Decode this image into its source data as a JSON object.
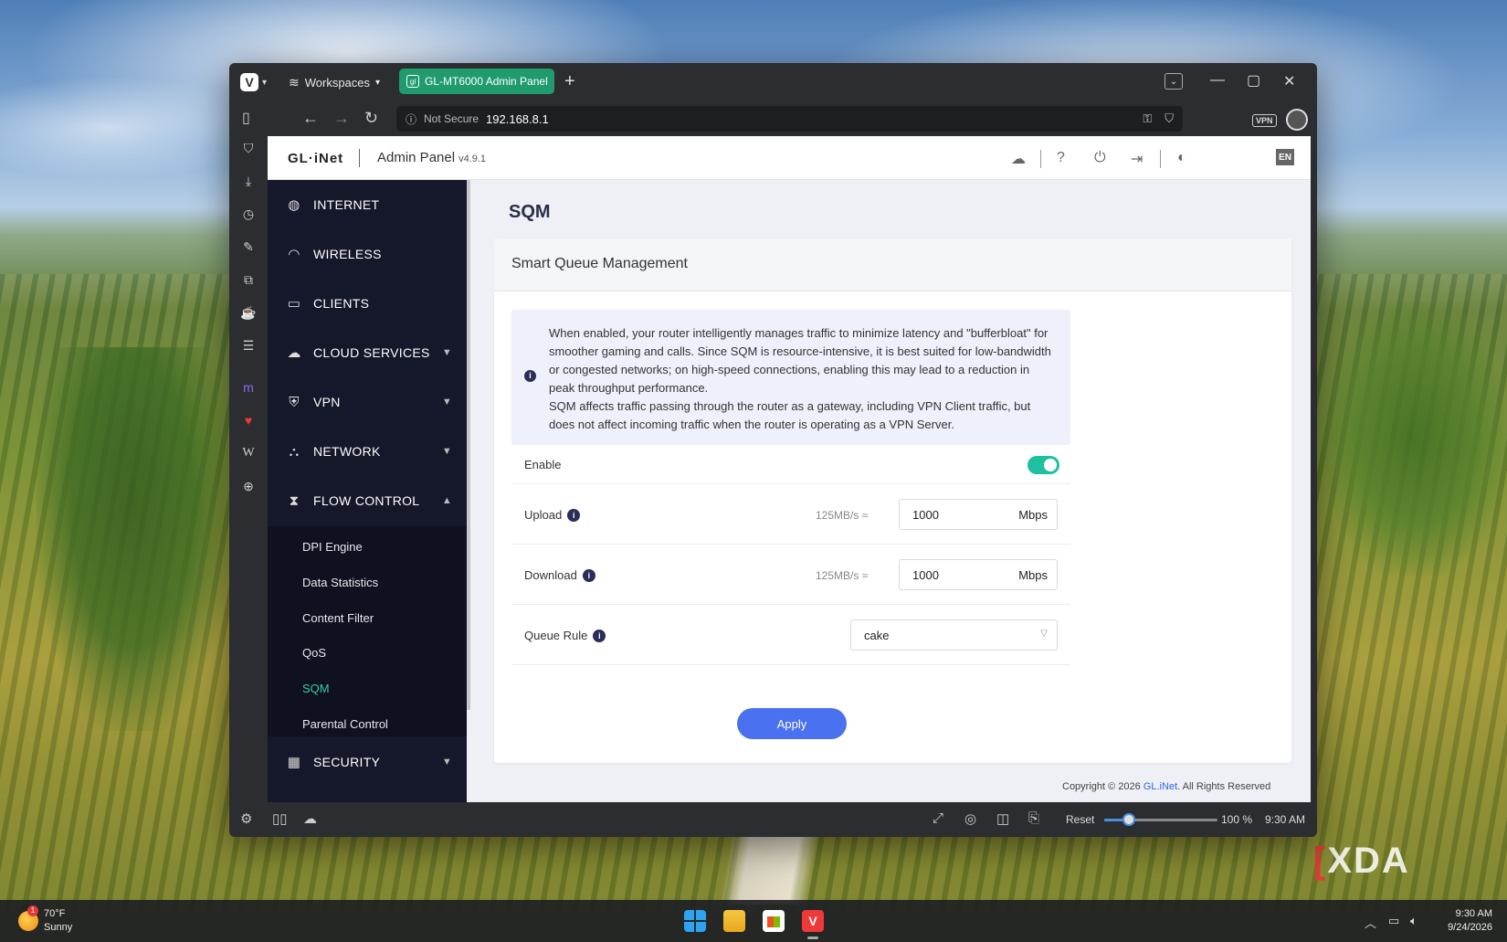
{
  "browser": {
    "workspaces_label": "Workspaces",
    "tab_title": "GL-MT6000 Admin Panel",
    "tab_favicon": "gl",
    "url_security": "Not Secure",
    "url_host": "192.168.8.1",
    "vpn_label": "VPN",
    "statusbar": {
      "reset_label": "Reset",
      "zoom_label": "100 %",
      "zoom_level": 0.22,
      "time": "9:30 AM"
    }
  },
  "header": {
    "logo": "GL·iNet",
    "title": "Admin Panel",
    "version": "v4.9.1",
    "lang": "EN"
  },
  "sidebar": {
    "items": [
      {
        "label": "INTERNET",
        "icon": "globe-icon"
      },
      {
        "label": "WIRELESS",
        "icon": "wifi-icon"
      },
      {
        "label": "CLIENTS",
        "icon": "devices-icon"
      },
      {
        "label": "CLOUD SERVICES",
        "icon": "cloud-icon",
        "expandable": true
      },
      {
        "label": "VPN",
        "icon": "shield-icon",
        "expandable": true
      },
      {
        "label": "NETWORK",
        "icon": "network-icon",
        "expandable": true
      },
      {
        "label": "FLOW CONTROL",
        "icon": "flow-icon",
        "expanded": true
      },
      {
        "label": "SECURITY",
        "icon": "security-icon",
        "expandable": true
      }
    ],
    "flow_control_sub": [
      "DPI Engine",
      "Data Statistics",
      "Content Filter",
      "QoS",
      "SQM",
      "Parental Control"
    ],
    "active_sub": "SQM"
  },
  "main": {
    "page_title": "SQM",
    "card_title": "Smart Queue Management",
    "info_text": "When enabled, your router intelligently manages traffic to minimize latency and \"bufferbloat\" for smoother gaming and calls. Since SQM is resource-intensive, it is best suited for low-bandwidth or congested networks; on high-speed connections, enabling this may lead to a reduction in peak throughput performance.",
    "info_text_2": "SQM affects traffic passing through the router as a gateway, including VPN Client traffic, but does not affect incoming traffic when the router is operating as a VPN Server.",
    "enable_label": "Enable",
    "enable_on": true,
    "upload": {
      "label": "Upload",
      "approx": "125MB/s ≈",
      "value": "1000",
      "unit": "Mbps"
    },
    "download": {
      "label": "Download",
      "approx": "125MB/s ≈",
      "value": "1000",
      "unit": "Mbps"
    },
    "queue_rule": {
      "label": "Queue Rule",
      "value": "cake"
    },
    "apply_label": "Apply",
    "footer_prefix": "Copyright © 2026 ",
    "footer_link": "GL.iNet",
    "footer_suffix": ". All Rights Reserved"
  },
  "taskbar": {
    "weather_temp": "70°F",
    "weather_cond": "Sunny",
    "weather_badge": "1",
    "time": "9:30 AM",
    "date": "9/24/2026"
  },
  "watermark": "XDA",
  "colors": {
    "accent_green": "#1fc0a0",
    "apply_blue": "#4a72f0",
    "sidebar_bg": "#15172a",
    "tab_green": "#1f9b6e"
  }
}
